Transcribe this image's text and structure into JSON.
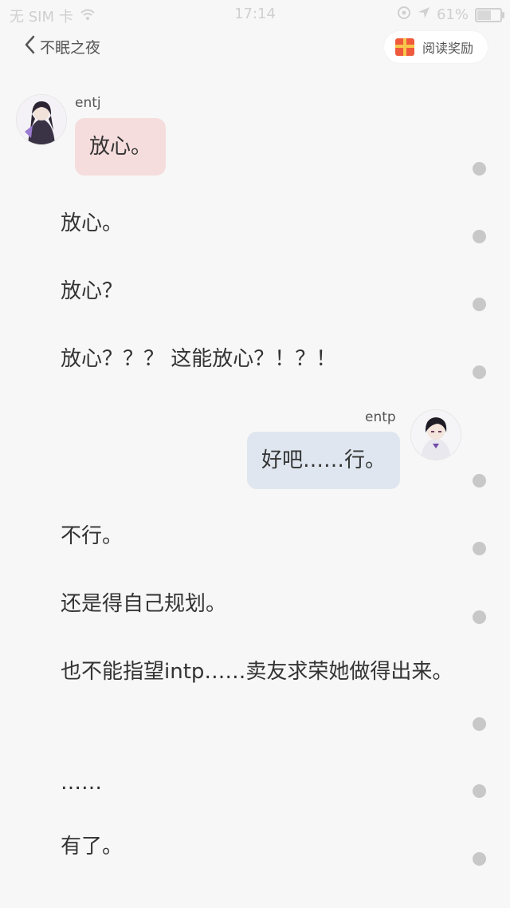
{
  "status_bar": {
    "carrier": "无 SIM 卡",
    "time": "17:14",
    "battery": "61%",
    "battery_level": 0.61
  },
  "nav": {
    "title": "不眠之夜",
    "reward_label": "阅读奖励"
  },
  "messages": {
    "m1": {
      "speaker": "entj",
      "text": "放心。"
    },
    "m2": {
      "speaker": "entp",
      "text": "好吧……行。"
    }
  },
  "paragraphs": {
    "p1": "放心。",
    "p2": "放心？",
    "p3": "放心？？？ 这能放心？！？！",
    "p4": "不行。",
    "p5": "还是得自己规划。",
    "p6": "也不能指望intp……卖友求荣她做得出来。",
    "p7": "……",
    "p8": "有了。"
  },
  "colors": {
    "background": "#f7f7f7",
    "bubble_left": "#f6dddd",
    "bubble_right": "#dfe6ef",
    "dot": "#c8c8c8"
  }
}
